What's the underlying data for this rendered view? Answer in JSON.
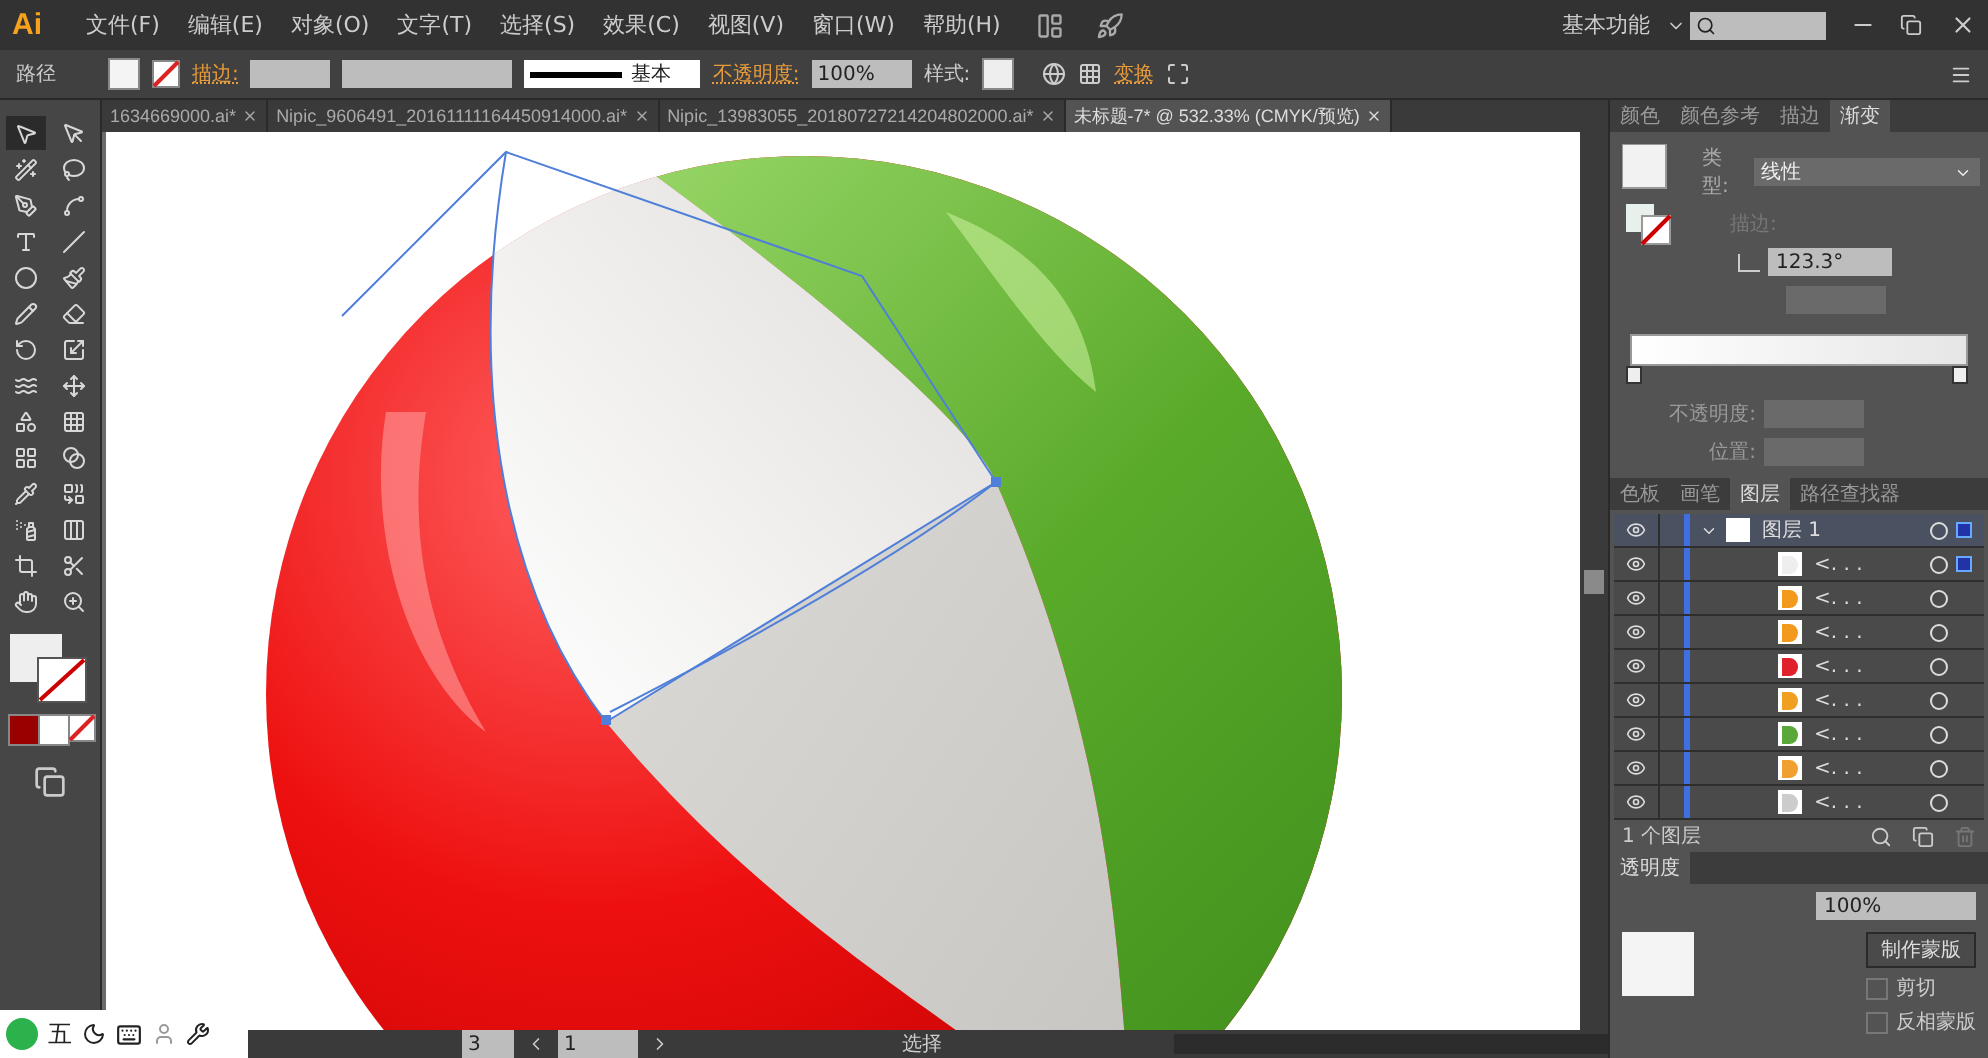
{
  "menu_bar": {
    "logo": "Ai",
    "items": [
      "文件(F)",
      "编辑(E)",
      "对象(O)",
      "文字(T)",
      "选择(S)",
      "效果(C)",
      "视图(V)",
      "窗口(W)",
      "帮助(H)"
    ],
    "workspace": "基本功能"
  },
  "control_bar": {
    "object_type": "路径",
    "stroke_label": "描边:",
    "stroke_profile": "基本",
    "opacity_label": "不透明度:",
    "opacity_value": "100%",
    "style_label": "样式:",
    "transform_link": "变换"
  },
  "doc_tabs": [
    {
      "label": "1634669000.ai*",
      "selected": false
    },
    {
      "label": "Nipic_9606491_20161111164450914000.ai*",
      "selected": false
    },
    {
      "label": "Nipic_13983055_20180727214204802000.ai*",
      "selected": false
    },
    {
      "label": "未标题-7* @ 532.33% (CMYK/预览)",
      "selected": true
    }
  ],
  "tools": [
    {
      "kind": "select",
      "selected": true
    },
    {
      "kind": "direct",
      "selected": false
    },
    {
      "kind": "wand",
      "selected": false
    },
    {
      "kind": "lasso",
      "selected": false
    },
    {
      "kind": "pen",
      "selected": false
    },
    {
      "kind": "curve",
      "selected": false
    },
    {
      "kind": "type",
      "selected": false
    },
    {
      "kind": "line",
      "selected": false
    },
    {
      "kind": "ellipse",
      "selected": false
    },
    {
      "kind": "brush",
      "selected": false
    },
    {
      "kind": "pencil",
      "selected": false
    },
    {
      "kind": "eraser",
      "selected": false
    },
    {
      "kind": "rotate",
      "selected": false
    },
    {
      "kind": "scale",
      "selected": false
    },
    {
      "kind": "warp",
      "selected": false
    },
    {
      "kind": "transform",
      "selected": false
    },
    {
      "kind": "shapes",
      "selected": false
    },
    {
      "kind": "grid",
      "selected": false
    },
    {
      "kind": "mesh",
      "selected": false
    },
    {
      "kind": "gradient",
      "selected": false
    },
    {
      "kind": "eyedropper",
      "selected": false
    },
    {
      "kind": "blend",
      "selected": false
    },
    {
      "kind": "spray",
      "selected": false
    },
    {
      "kind": "chart",
      "selected": false
    },
    {
      "kind": "crop",
      "selected": false
    },
    {
      "kind": "slice",
      "selected": false
    },
    {
      "kind": "hand",
      "selected": false
    },
    {
      "kind": "zoom",
      "selected": false
    }
  ],
  "gradient_panel": {
    "tabs": [
      {
        "label": "颜色",
        "selected": false
      },
      {
        "label": "颜色参考",
        "selected": false
      },
      {
        "label": "描边",
        "selected": false
      },
      {
        "label": "渐变",
        "selected": true
      }
    ],
    "type_label": "类型:",
    "type_value": "线性",
    "stroke_label": "描边:",
    "angle": "123.3°",
    "opacity_label": "不透明度:",
    "position_label": "位置:"
  },
  "layers_panel": {
    "tabs": [
      {
        "label": "色板",
        "selected": false
      },
      {
        "label": "画笔",
        "selected": false
      },
      {
        "label": "图层",
        "selected": true
      },
      {
        "label": "路径查找器",
        "selected": false
      }
    ],
    "layer": {
      "name": "图层 1",
      "expanded": true,
      "selected": true,
      "children": [
        {
          "name": "<. . .",
          "color": "#eeeeee",
          "selected": true
        },
        {
          "name": "<. . .",
          "color": "#f39a1e",
          "selected": false
        },
        {
          "name": "<. . .",
          "color": "#f39a1e",
          "selected": false
        },
        {
          "name": "<. . .",
          "color": "#e0202a",
          "selected": false
        },
        {
          "name": "<. . .",
          "color": "#f0a020",
          "selected": false
        },
        {
          "name": "<. . .",
          "color": "#5aa83a",
          "selected": false
        },
        {
          "name": "<. . .",
          "color": "#f0a030",
          "selected": false
        },
        {
          "name": "<. . .",
          "color": "#cccccc",
          "selected": false
        }
      ]
    },
    "count": "1 个图层"
  },
  "transparency_panel": {
    "title": "透明度",
    "opacity": "100%",
    "make_mask": "制作蒙版",
    "clip": {
      "label": "剪切",
      "checked": false
    },
    "invert_mask": {
      "label": "反相蒙版",
      "checked": false
    }
  },
  "ime_bar": {
    "label": "五"
  },
  "status_bar": {
    "zoom": "3",
    "page": "1",
    "status": "选择"
  }
}
